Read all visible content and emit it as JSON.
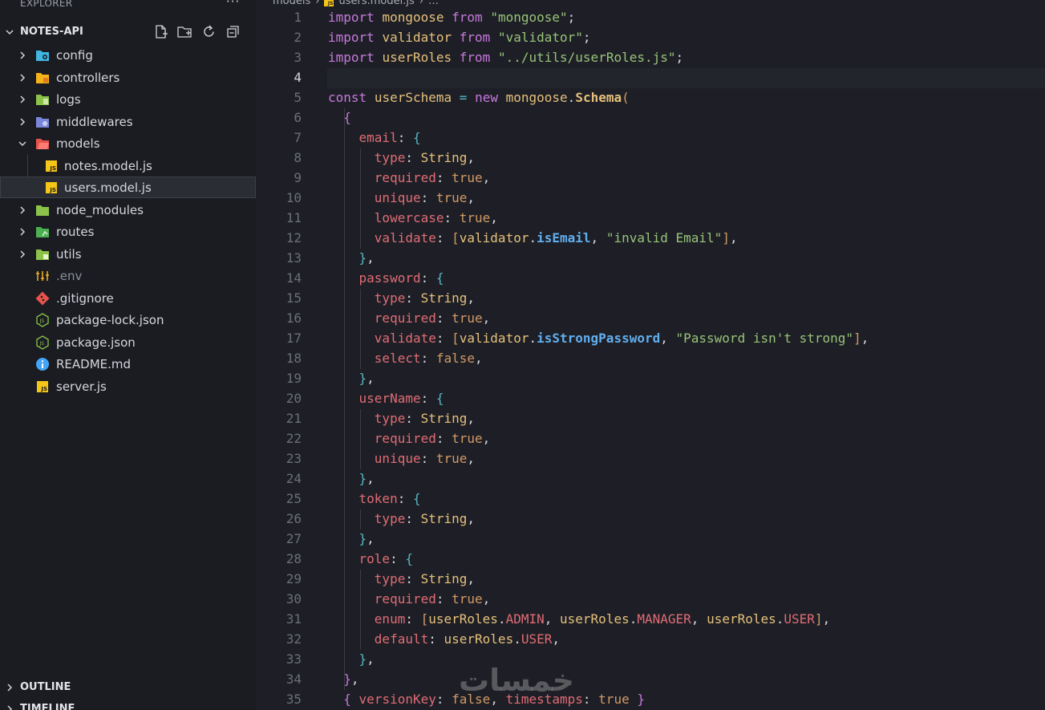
{
  "sidebar": {
    "header": "EXPLORER",
    "more": "···",
    "project": "NOTES-API",
    "tree": [
      {
        "label": "config",
        "type": "folder",
        "icon": "config-folder-icon",
        "color": "#3fb5e0",
        "expanded": false
      },
      {
        "label": "controllers",
        "type": "folder",
        "icon": "controllers-folder-icon",
        "color": "#f5b31b",
        "expanded": false
      },
      {
        "label": "logs",
        "type": "folder",
        "icon": "logs-folder-icon",
        "color": "#8bc34a",
        "expanded": false
      },
      {
        "label": "middlewares",
        "type": "folder",
        "icon": "middlewares-folder-icon",
        "color": "#7a86d9",
        "expanded": false
      },
      {
        "label": "models",
        "type": "folder",
        "icon": "models-folder-icon",
        "color": "#e5534b",
        "expanded": true
      },
      {
        "label": "notes.model.js",
        "type": "file",
        "icon": "js-file-icon"
      },
      {
        "label": "users.model.js",
        "type": "file",
        "icon": "js-file-icon",
        "selected": true
      },
      {
        "label": "node_modules",
        "type": "folder",
        "icon": "node-modules-folder-icon",
        "color": "#8bc34a",
        "expanded": false
      },
      {
        "label": "routes",
        "type": "folder",
        "icon": "routes-folder-icon",
        "color": "#4caf50",
        "expanded": false
      },
      {
        "label": "utils",
        "type": "folder",
        "icon": "utils-folder-icon",
        "color": "#8bc34a",
        "expanded": false
      },
      {
        "label": ".env",
        "type": "file",
        "icon": "env-file-icon"
      },
      {
        "label": ".gitignore",
        "type": "file",
        "icon": "git-file-icon"
      },
      {
        "label": "package-lock.json",
        "type": "file",
        "icon": "nodejs-file-icon"
      },
      {
        "label": "package.json",
        "type": "file",
        "icon": "nodejs-file-icon"
      },
      {
        "label": "README.md",
        "type": "file",
        "icon": "info-file-icon"
      },
      {
        "label": "server.js",
        "type": "file",
        "icon": "js-file-icon"
      }
    ],
    "outline": "OUTLINE",
    "timeline": "TIMELINE"
  },
  "breadcrumb": {
    "folder": "models",
    "sep": "›",
    "file": "users.model.js",
    "more": "…"
  },
  "editor": {
    "active_line": 4,
    "line_numbers": [
      "1",
      "2",
      "3",
      "4",
      "5",
      "6",
      "7",
      "8",
      "9",
      "10",
      "11",
      "12",
      "13",
      "14",
      "15",
      "16",
      "17",
      "18",
      "19",
      "20",
      "21",
      "22",
      "23",
      "24",
      "25",
      "26",
      "27",
      "28",
      "29",
      "30",
      "31",
      "32",
      "33",
      "34",
      "35"
    ],
    "lines": [
      [
        [
          "kw",
          "import"
        ],
        [
          "t",
          " "
        ],
        [
          "id",
          "mongoose"
        ],
        [
          "t",
          " "
        ],
        [
          "kw",
          "from"
        ],
        [
          "t",
          " "
        ],
        [
          "str",
          "\"mongoose\""
        ],
        [
          "t",
          ";"
        ]
      ],
      [
        [
          "kw",
          "import"
        ],
        [
          "t",
          " "
        ],
        [
          "id",
          "validator"
        ],
        [
          "t",
          " "
        ],
        [
          "kw",
          "from"
        ],
        [
          "t",
          " "
        ],
        [
          "str",
          "\"validator\""
        ],
        [
          "t",
          ";"
        ]
      ],
      [
        [
          "kw",
          "import"
        ],
        [
          "t",
          " "
        ],
        [
          "id",
          "userRoles"
        ],
        [
          "t",
          " "
        ],
        [
          "kw",
          "from"
        ],
        [
          "t",
          " "
        ],
        [
          "str",
          "\"../utils/userRoles.js\""
        ],
        [
          "t",
          ";"
        ]
      ],
      [],
      [
        [
          "kw",
          "const"
        ],
        [
          "t",
          " "
        ],
        [
          "id",
          "userSchema"
        ],
        [
          "t",
          " "
        ],
        [
          "br3",
          "="
        ],
        [
          "t",
          " "
        ],
        [
          "kw",
          "new"
        ],
        [
          "t",
          " "
        ],
        [
          "id",
          "mongoose"
        ],
        [
          "t",
          "."
        ],
        [
          "meth",
          "Schema"
        ],
        [
          "br1",
          "("
        ]
      ],
      [
        [
          "t",
          "  "
        ],
        [
          "br2",
          "{"
        ]
      ],
      [
        [
          "t",
          "    "
        ],
        [
          "prop",
          "email"
        ],
        [
          "t",
          ": "
        ],
        [
          "br3",
          "{"
        ]
      ],
      [
        [
          "t",
          "      "
        ],
        [
          "prop",
          "type"
        ],
        [
          "t",
          ": "
        ],
        [
          "obj",
          "String"
        ],
        [
          "t",
          ","
        ]
      ],
      [
        [
          "t",
          "      "
        ],
        [
          "prop",
          "required"
        ],
        [
          "t",
          ": "
        ],
        [
          "val",
          "true"
        ],
        [
          "t",
          ","
        ]
      ],
      [
        [
          "t",
          "      "
        ],
        [
          "prop",
          "unique"
        ],
        [
          "t",
          ": "
        ],
        [
          "val",
          "true"
        ],
        [
          "t",
          ","
        ]
      ],
      [
        [
          "t",
          "      "
        ],
        [
          "prop",
          "lowercase"
        ],
        [
          "t",
          ": "
        ],
        [
          "val",
          "true"
        ],
        [
          "t",
          ","
        ]
      ],
      [
        [
          "t",
          "      "
        ],
        [
          "prop",
          "validate"
        ],
        [
          "t",
          ": "
        ],
        [
          "br1",
          "["
        ],
        [
          "id",
          "validator"
        ],
        [
          "t",
          "."
        ],
        [
          "fn",
          "isEmail"
        ],
        [
          "t",
          ", "
        ],
        [
          "str",
          "\"invalid Email\""
        ],
        [
          "br1",
          "]"
        ],
        [
          "t",
          ","
        ]
      ],
      [
        [
          "t",
          "    "
        ],
        [
          "br3",
          "}"
        ],
        [
          "t",
          ","
        ]
      ],
      [
        [
          "t",
          "    "
        ],
        [
          "prop",
          "password"
        ],
        [
          "t",
          ": "
        ],
        [
          "br3",
          "{"
        ]
      ],
      [
        [
          "t",
          "      "
        ],
        [
          "prop",
          "type"
        ],
        [
          "t",
          ": "
        ],
        [
          "obj",
          "String"
        ],
        [
          "t",
          ","
        ]
      ],
      [
        [
          "t",
          "      "
        ],
        [
          "prop",
          "required"
        ],
        [
          "t",
          ": "
        ],
        [
          "val",
          "true"
        ],
        [
          "t",
          ","
        ]
      ],
      [
        [
          "t",
          "      "
        ],
        [
          "prop",
          "validate"
        ],
        [
          "t",
          ": "
        ],
        [
          "br1",
          "["
        ],
        [
          "id",
          "validator"
        ],
        [
          "t",
          "."
        ],
        [
          "fn",
          "isStrongPassword"
        ],
        [
          "t",
          ", "
        ],
        [
          "str",
          "\"Password isn't strong\""
        ],
        [
          "br1",
          "]"
        ],
        [
          "t",
          ","
        ]
      ],
      [
        [
          "t",
          "      "
        ],
        [
          "prop",
          "select"
        ],
        [
          "t",
          ": "
        ],
        [
          "val",
          "false"
        ],
        [
          "t",
          ","
        ]
      ],
      [
        [
          "t",
          "    "
        ],
        [
          "br3",
          "}"
        ],
        [
          "t",
          ","
        ]
      ],
      [
        [
          "t",
          "    "
        ],
        [
          "prop",
          "userName"
        ],
        [
          "t",
          ": "
        ],
        [
          "br3",
          "{"
        ]
      ],
      [
        [
          "t",
          "      "
        ],
        [
          "prop",
          "type"
        ],
        [
          "t",
          ": "
        ],
        [
          "obj",
          "String"
        ],
        [
          "t",
          ","
        ]
      ],
      [
        [
          "t",
          "      "
        ],
        [
          "prop",
          "required"
        ],
        [
          "t",
          ": "
        ],
        [
          "val",
          "true"
        ],
        [
          "t",
          ","
        ]
      ],
      [
        [
          "t",
          "      "
        ],
        [
          "prop",
          "unique"
        ],
        [
          "t",
          ": "
        ],
        [
          "val",
          "true"
        ],
        [
          "t",
          ","
        ]
      ],
      [
        [
          "t",
          "    "
        ],
        [
          "br3",
          "}"
        ],
        [
          "t",
          ","
        ]
      ],
      [
        [
          "t",
          "    "
        ],
        [
          "prop",
          "token"
        ],
        [
          "t",
          ": "
        ],
        [
          "br3",
          "{"
        ]
      ],
      [
        [
          "t",
          "      "
        ],
        [
          "prop",
          "type"
        ],
        [
          "t",
          ": "
        ],
        [
          "obj",
          "String"
        ],
        [
          "t",
          ","
        ]
      ],
      [
        [
          "t",
          "    "
        ],
        [
          "br3",
          "}"
        ],
        [
          "t",
          ","
        ]
      ],
      [
        [
          "t",
          "    "
        ],
        [
          "prop",
          "role"
        ],
        [
          "t",
          ": "
        ],
        [
          "br3",
          "{"
        ]
      ],
      [
        [
          "t",
          "      "
        ],
        [
          "prop",
          "type"
        ],
        [
          "t",
          ": "
        ],
        [
          "obj",
          "String"
        ],
        [
          "t",
          ","
        ]
      ],
      [
        [
          "t",
          "      "
        ],
        [
          "prop",
          "required"
        ],
        [
          "t",
          ": "
        ],
        [
          "val",
          "true"
        ],
        [
          "t",
          ","
        ]
      ],
      [
        [
          "t",
          "      "
        ],
        [
          "prop",
          "enum"
        ],
        [
          "t",
          ": "
        ],
        [
          "br1",
          "["
        ],
        [
          "id",
          "userRoles"
        ],
        [
          "t",
          "."
        ],
        [
          "const",
          "ADMIN"
        ],
        [
          "t",
          ", "
        ],
        [
          "id",
          "userRoles"
        ],
        [
          "t",
          "."
        ],
        [
          "const",
          "MANAGER"
        ],
        [
          "t",
          ", "
        ],
        [
          "id",
          "userRoles"
        ],
        [
          "t",
          "."
        ],
        [
          "const",
          "USER"
        ],
        [
          "br1",
          "]"
        ],
        [
          "t",
          ","
        ]
      ],
      [
        [
          "t",
          "      "
        ],
        [
          "prop",
          "default"
        ],
        [
          "t",
          ": "
        ],
        [
          "id",
          "userRoles"
        ],
        [
          "t",
          "."
        ],
        [
          "const",
          "USER"
        ],
        [
          "t",
          ","
        ]
      ],
      [
        [
          "t",
          "    "
        ],
        [
          "br3",
          "}"
        ],
        [
          "t",
          ","
        ]
      ],
      [
        [
          "t",
          "  "
        ],
        [
          "br2",
          "}"
        ],
        [
          "t",
          ","
        ]
      ],
      [
        [
          "t",
          "  "
        ],
        [
          "br2",
          "{"
        ],
        [
          "t",
          " "
        ],
        [
          "prop",
          "versionKey"
        ],
        [
          "t",
          ": "
        ],
        [
          "val",
          "false"
        ],
        [
          "t",
          ", "
        ],
        [
          "prop",
          "timestamps"
        ],
        [
          "t",
          ": "
        ],
        [
          "val",
          "true"
        ],
        [
          "t",
          " "
        ],
        [
          "br2",
          "}"
        ]
      ]
    ]
  },
  "watermark": "خمسات"
}
